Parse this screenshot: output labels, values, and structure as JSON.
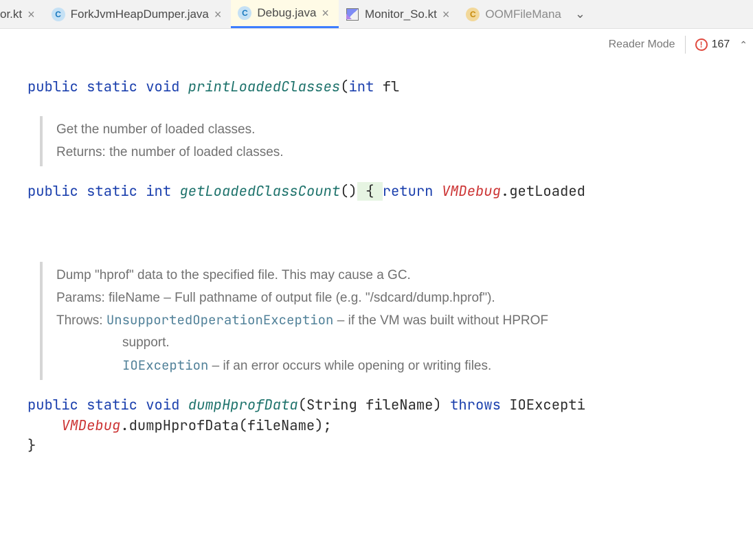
{
  "tabs": [
    {
      "label": "or.kt",
      "icon": "none",
      "partial": true
    },
    {
      "label": "ForkJvmHeapDumper.java",
      "icon": "class-c"
    },
    {
      "label": "Debug.java",
      "icon": "class-c",
      "active": true
    },
    {
      "label": "Monitor_So.kt",
      "icon": "kotlin"
    },
    {
      "label": "OOMFileMana",
      "icon": "class-c green",
      "truncated": true
    }
  ],
  "topbar": {
    "reader_mode": "Reader Mode",
    "error_count": "167"
  },
  "code": {
    "l1_kw1": "public",
    "l1_kw2": "static",
    "l1_kw3": "void",
    "l1_ident": "printLoadedClasses",
    "l1_paren": "(",
    "l1_type": "int",
    "l1_param": " fl",
    "doc1_line1": "Get the number of loaded classes.",
    "doc1_line2": "Returns:  the number of loaded classes.",
    "l2_kw1": "public",
    "l2_kw2": "static",
    "l2_kw3": "int",
    "l2_ident": "getLoadedClassCount",
    "l2_parens": "()",
    "l2_brace": " { ",
    "l2_ret": "return",
    "l2_obj": "VMDebug",
    "l2_tail": ".getLoaded",
    "doc2_line1": "Dump \"hprof\" data to the specified file. This may cause a GC.",
    "doc2_params_label": "Params:",
    "doc2_params_text": "  fileName – Full pathname of output file (e.g. \"/sdcard/dump.hprof\").",
    "doc2_throws_label": "Throws:",
    "doc2_exc1": "UnsupportedOperationException",
    "doc2_exc1_text": " – if the VM was built without HPROF",
    "doc2_exc1_cont": "support.",
    "doc2_exc2": "IOException",
    "doc2_exc2_text": " – if an error occurs while opening or writing files.",
    "l3_kw1": "public",
    "l3_kw2": "static",
    "l3_kw3": "void",
    "l3_ident": "dumpHprofData",
    "l3_sig_open": "(String fileName) ",
    "l3_throws": "throws",
    "l3_exc": " IOExcepti",
    "l4_obj": "VMDebug",
    "l4_tail": ".dumpHprofData(fileName);",
    "l5_brace": "}"
  }
}
